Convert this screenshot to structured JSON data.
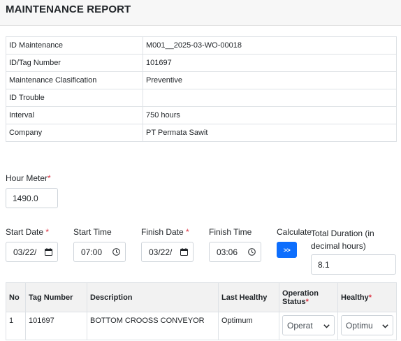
{
  "header": {
    "title": "MAINTENANCE REPORT"
  },
  "info": {
    "rows": [
      {
        "label": "ID Maintenance",
        "value": "M001__2025-03-WO-00018"
      },
      {
        "label": "ID/Tag Number",
        "value": "101697"
      },
      {
        "label": "Maintenance Clasification",
        "value": "Preventive"
      },
      {
        "label": "ID Trouble",
        "value": ""
      },
      {
        "label": "Interval",
        "value": "750 hours"
      },
      {
        "label": "Company",
        "value": "PT Permata Sawit"
      }
    ]
  },
  "form": {
    "hour_meter": {
      "label": "Hour Meter",
      "value": "1490.0"
    },
    "start_date": {
      "label": "Start Date",
      "value": "03/22/"
    },
    "start_time": {
      "label": "Start Time",
      "value": "07:00"
    },
    "finish_date": {
      "label": "Finish Date",
      "value": "03/22/"
    },
    "finish_time": {
      "label": "Finish Time",
      "value": "03:06"
    },
    "calculate": {
      "label": "Calculate",
      "button": ">>"
    },
    "total_duration": {
      "label": "Total Duration (in decimal hours)",
      "value": "8.1"
    },
    "required_mark": "*"
  },
  "items": {
    "headers": {
      "no": "No",
      "tag": "Tag Number",
      "desc": "Description",
      "last": "Last Healthy",
      "opstatus": "Operation Status",
      "healthy": "Healthy"
    },
    "rows": [
      {
        "no": "1",
        "tag": "101697",
        "desc": "BOTTOM CROOSS CONVEYOR",
        "last": "Optimum",
        "opstatus": "Operat",
        "healthy": "Optimu"
      }
    ]
  },
  "colors": {
    "accent": "#0d6efd",
    "required": "#dc3545"
  }
}
